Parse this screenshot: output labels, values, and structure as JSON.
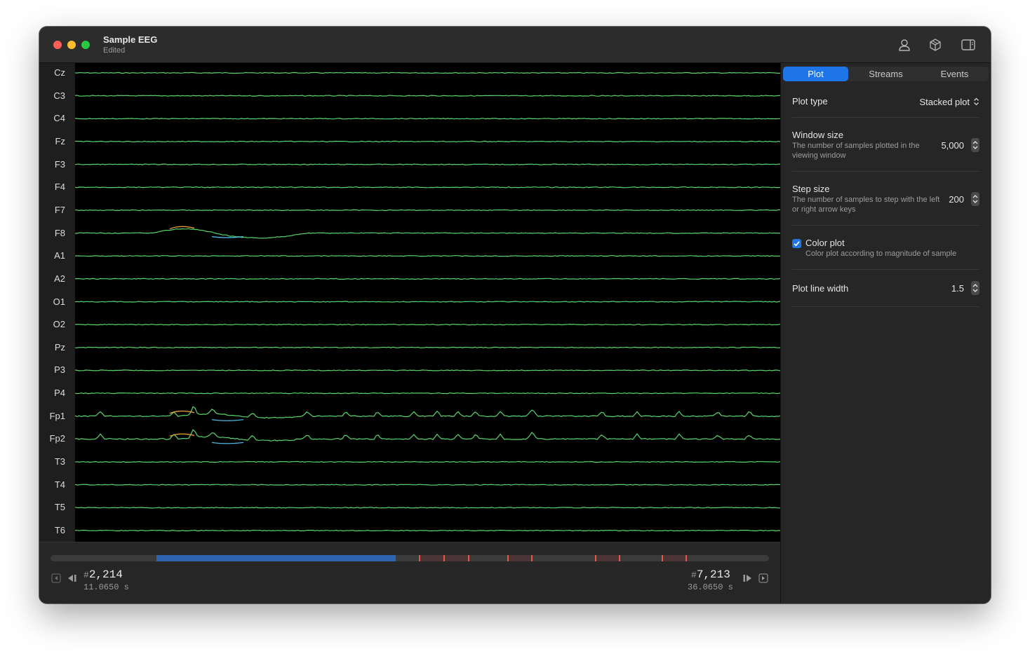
{
  "window": {
    "title": "Sample EEG",
    "subtitle": "Edited"
  },
  "toolbar": {
    "icons": [
      "person-icon",
      "cube-icon",
      "sidebar-toggle-icon"
    ]
  },
  "channels": [
    "Cz",
    "C3",
    "C4",
    "Fz",
    "F3",
    "F4",
    "F7",
    "F8",
    "A1",
    "A2",
    "O1",
    "O2",
    "Pz",
    "P3",
    "P4",
    "Fp1",
    "Fp2",
    "T3",
    "T4",
    "T5",
    "T6"
  ],
  "colors": {
    "trace": "#58d66a",
    "high_magnitude": "#f0a534",
    "low_magnitude": "#4fb7e3",
    "accent": "#1f74e8",
    "event_marker": "#e45a4a"
  },
  "navigation": {
    "start_sample": "2,214",
    "start_time": "11.0650 s",
    "end_sample": "7,213",
    "end_time": "36.0650 s",
    "hash": "#",
    "first_icon": "skip-to-start-icon",
    "prev_icon": "step-back-icon",
    "next_icon": "step-forward-icon",
    "last_icon": "skip-to-end-icon"
  },
  "tabs": [
    {
      "label": "Plot",
      "active": true
    },
    {
      "label": "Streams",
      "active": false
    },
    {
      "label": "Events",
      "active": false
    }
  ],
  "settings": {
    "plot_type": {
      "label": "Plot type",
      "value": "Stacked plot"
    },
    "window_size": {
      "label": "Window size",
      "description": "The number of samples plotted in the viewing window",
      "value": "5,000"
    },
    "step_size": {
      "label": "Step size",
      "description": "The number of samples to step with the left or right arrow keys",
      "value": "200"
    },
    "color_plot": {
      "label": "Color plot",
      "description": "Color plot according to magnitude of sample",
      "checked": true
    },
    "line_width": {
      "label": "Plot line width",
      "value": "1.5"
    }
  }
}
